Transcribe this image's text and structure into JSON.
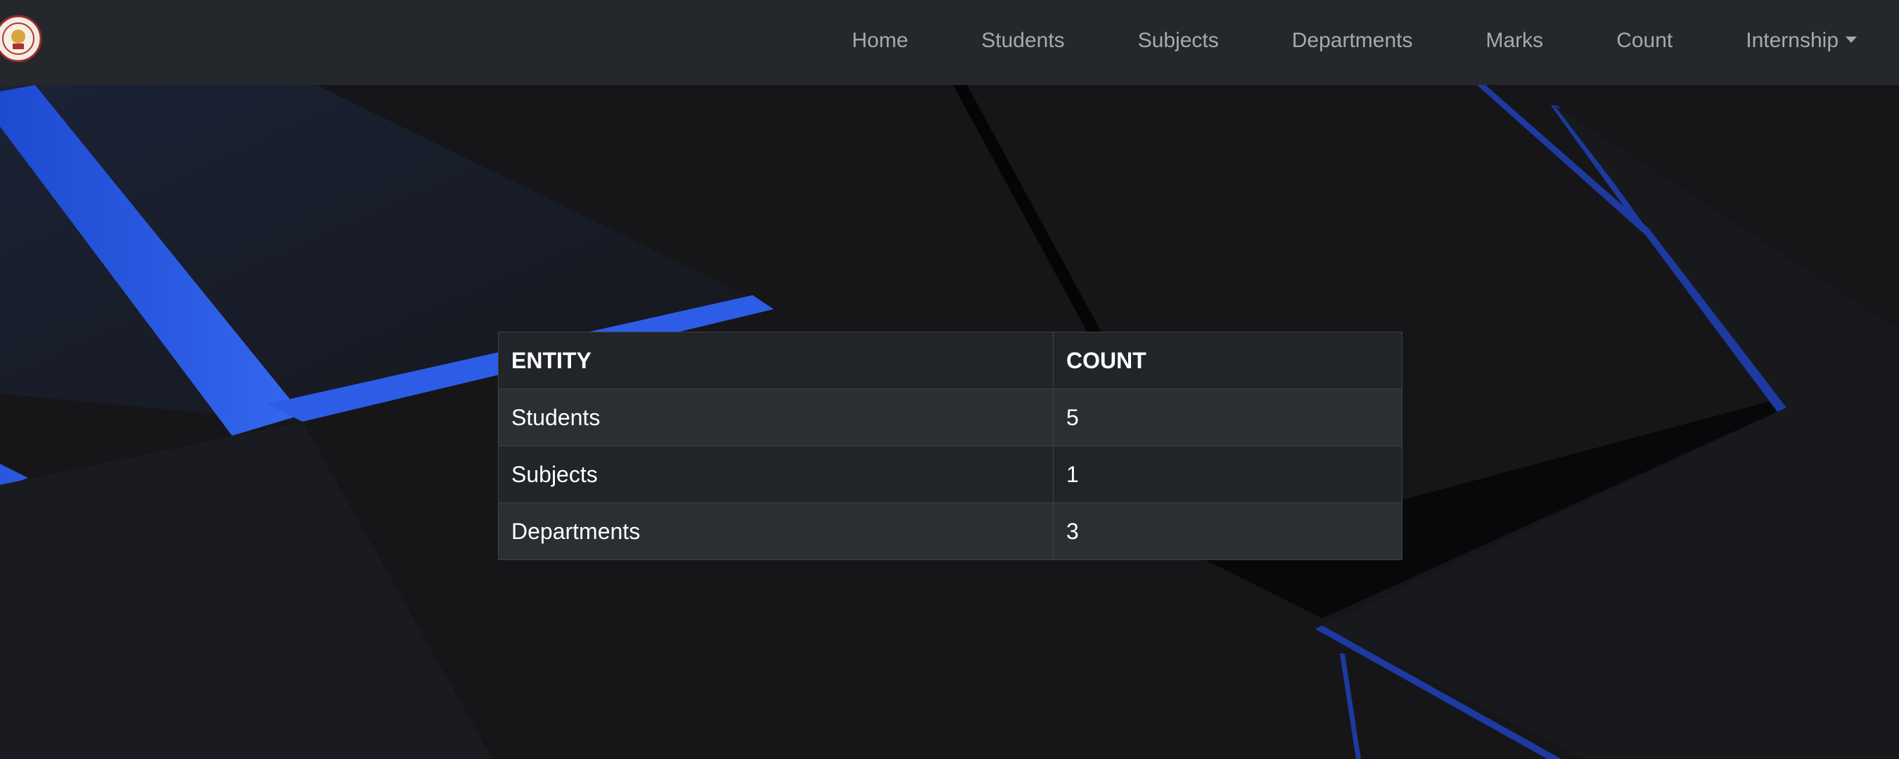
{
  "navbar": {
    "logo_icon": "college-emblem-icon",
    "links": [
      {
        "label": "Home"
      },
      {
        "label": "Students"
      },
      {
        "label": "Subjects"
      },
      {
        "label": "Departments"
      },
      {
        "label": "Marks"
      },
      {
        "label": "Count"
      },
      {
        "label": "Internship"
      }
    ],
    "dropdown_icon": "caret-down-icon"
  },
  "table": {
    "headers": [
      "ENTITY",
      "COUNT"
    ],
    "rows": [
      {
        "entity": "Students",
        "count": "5"
      },
      {
        "entity": "Subjects",
        "count": "1"
      },
      {
        "entity": "Departments",
        "count": "3"
      }
    ]
  },
  "colors": {
    "navbar_bg": "#24272b",
    "page_bg": "#161619",
    "accent_blue": "#2f5fe0",
    "nav_text": "#a6a9ad"
  }
}
